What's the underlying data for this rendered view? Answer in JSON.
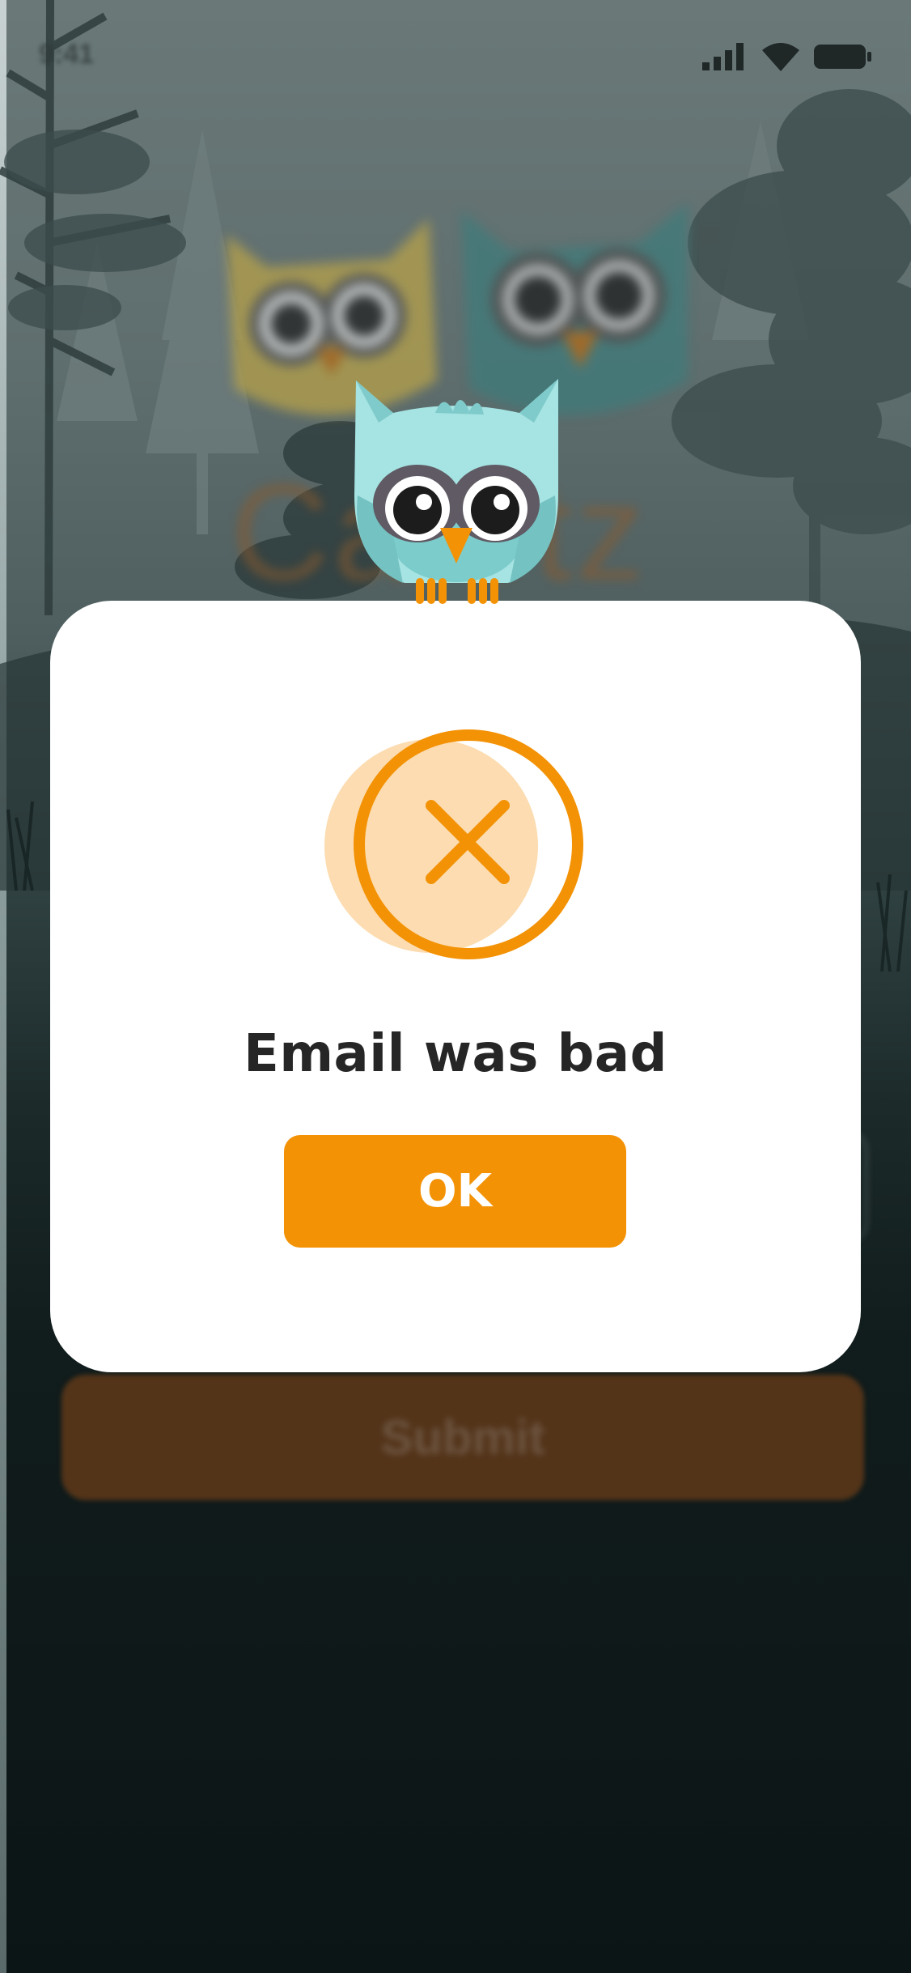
{
  "status_bar": {
    "time": "9:41",
    "icons": [
      "signal-icon",
      "wifi-icon",
      "battery-icon"
    ]
  },
  "background": {
    "logo_text": "Ca otz",
    "submit_label": "Submit"
  },
  "modal": {
    "message": "Email was bad",
    "ok_label": "OK",
    "icon": "error-x-icon",
    "mascot": "owl-icon"
  },
  "colors": {
    "accent": "#f39205",
    "accent_light": "#fcdcb0",
    "owl_body": "#a6e3e3",
    "text_dark": "#262626",
    "modal_bg": "#ffffff"
  }
}
